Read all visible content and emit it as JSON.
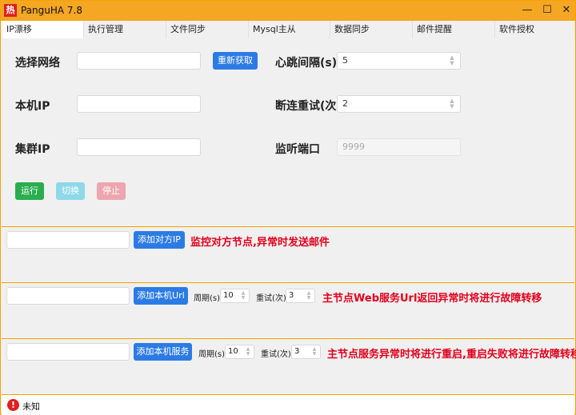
{
  "window": {
    "title": "PanguHA 7.8",
    "app_icon_glyph": "热",
    "minimize": "—",
    "maximize": "☐",
    "close": "✕"
  },
  "tabs": [
    {
      "label": "IP漂移"
    },
    {
      "label": "执行管理"
    },
    {
      "label": "文件同步"
    },
    {
      "label": "Mysql主从"
    },
    {
      "label": "数据同步"
    },
    {
      "label": "邮件提醒"
    },
    {
      "label": "软件授权"
    }
  ],
  "ip_panel": {
    "select_network_label": "选择网络",
    "select_network_value": "",
    "refresh_button": "重新获取",
    "heartbeat_label": "心跳间隔(s)",
    "heartbeat_value": "5",
    "local_ip_label": "本机IP",
    "local_ip_value": "",
    "retry_label": "断连重试(次)",
    "retry_value": "2",
    "cluster_ip_label": "集群IP",
    "cluster_ip_value": "",
    "listen_port_label": "监听端口",
    "listen_port_placeholder": "9999",
    "run_button": "运行",
    "switch_button": "切换",
    "stop_button": "停止"
  },
  "peer_section": {
    "input_value": "",
    "add_button": "添加对方IP",
    "note": "监控对方节点,异常时发送邮件"
  },
  "url_section": {
    "input_value": "",
    "add_button": "添加本机Url",
    "period_label": "周期(s)",
    "period_value": "10",
    "retry_label": "重试(次)",
    "retry_value": "3",
    "note": "主节点Web服务Url返回异常时将进行故障转移"
  },
  "service_section": {
    "input_value": "",
    "add_button": "添加本机服务",
    "period_label": "周期(s)",
    "period_value": "10",
    "retry_label": "重试(次)",
    "retry_value": "3",
    "note": "主节点服务异常时将进行重启,重启失败将进行故障转移"
  },
  "status": {
    "icon": "error-icon",
    "glyph": "!",
    "text": "未知"
  },
  "colors": {
    "title_bar": "#f5a623",
    "primary": "#2c7be5",
    "success": "#2aad4f",
    "danger_text": "#e3001b"
  }
}
